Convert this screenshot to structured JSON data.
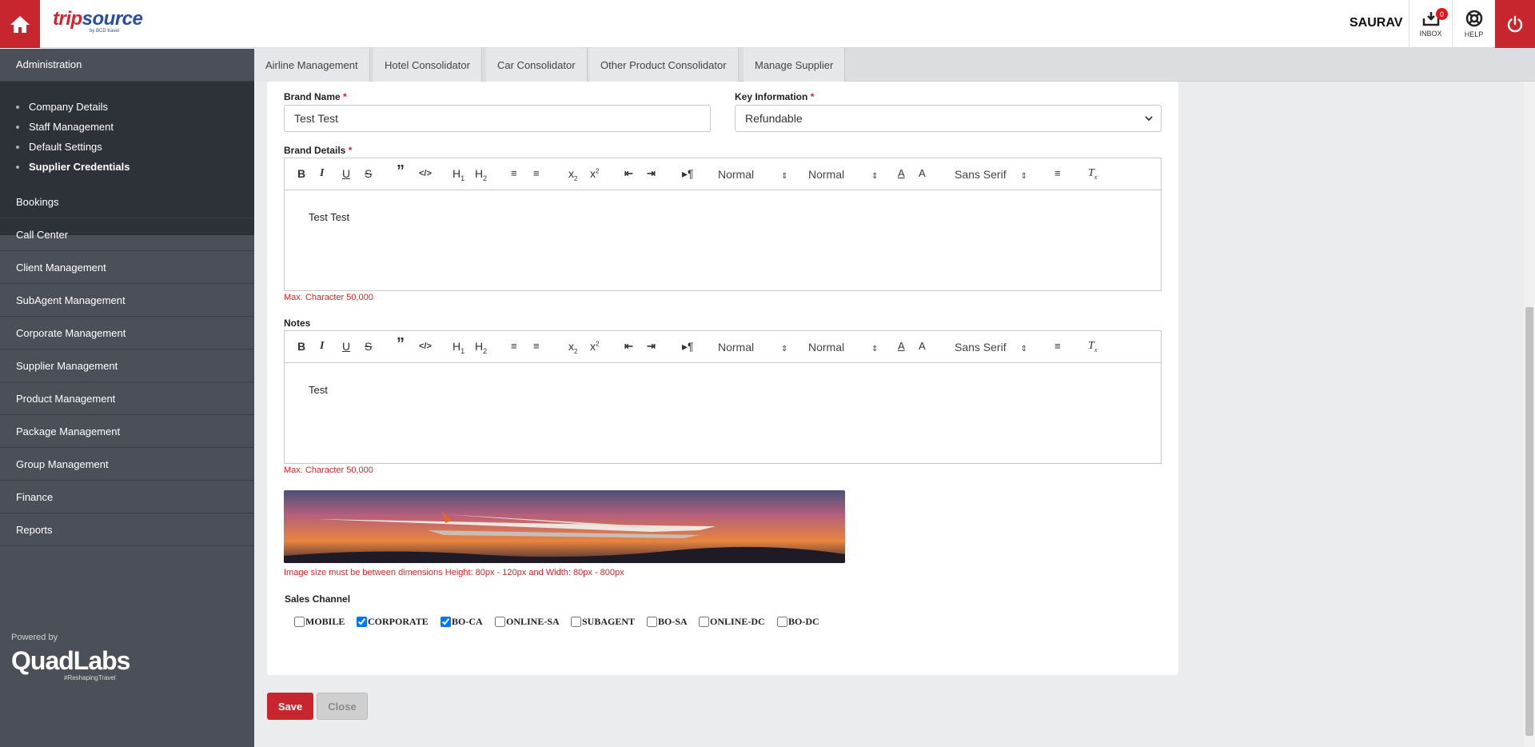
{
  "header": {
    "logo_trip": "trip",
    "logo_source": "source",
    "logo_sub": "by BCD travel",
    "user": "SAURAV",
    "inbox_label": "INBOX",
    "inbox_count": "0",
    "help_label": "HELP"
  },
  "sidebar": {
    "section": "Administration",
    "sub_items": [
      "Company Details",
      "Staff Management",
      "Default Settings",
      "Supplier Credentials"
    ],
    "active_sub": "Supplier Credentials",
    "items": [
      "Bookings",
      "Call Center",
      "Client Management",
      "SubAgent Management",
      "Corporate Management",
      "Supplier Management",
      "Product Management",
      "Package Management",
      "Group Management",
      "Finance",
      "Reports"
    ],
    "powered_by": "Powered by",
    "brand": "QuadLabs",
    "brand_tag": "#ReshapingTravel"
  },
  "tabs": [
    "Airline Management",
    "Hotel Consolidator",
    "Car Consolidator",
    "Other Product Consolidator",
    "Manage Supplier"
  ],
  "form": {
    "brand_name_label": "Brand Name",
    "brand_name_value": "Test Test",
    "key_info_label": "Key Information",
    "key_info_value": "Refundable",
    "brand_details_label": "Brand Details",
    "brand_details_text": "Test Test",
    "max_char": "Max. Character 50,000",
    "notes_label": "Notes",
    "notes_text": "Test",
    "picker_normal": "Normal",
    "picker_font": "Sans Serif",
    "image_note": "Image size must be between dimensions Height: 80px - 120px and Width: 80px - 800px",
    "sales_channel_label": "Sales Channel",
    "channels": [
      {
        "label": "MOBILE",
        "checked": false
      },
      {
        "label": "CORPORATE",
        "checked": true
      },
      {
        "label": "BO-CA",
        "checked": true
      },
      {
        "label": "ONLINE-SA",
        "checked": false
      },
      {
        "label": "SUBAGENT",
        "checked": false
      },
      {
        "label": "BO-SA",
        "checked": false
      },
      {
        "label": "ONLINE-DC",
        "checked": false
      },
      {
        "label": "BO-DC",
        "checked": false
      }
    ]
  },
  "buttons": {
    "save": "Save",
    "close": "Close"
  },
  "colors": {
    "accent": "#c8262e",
    "sidebar": "#4b5058",
    "sidebar_sub": "#2d3239"
  }
}
